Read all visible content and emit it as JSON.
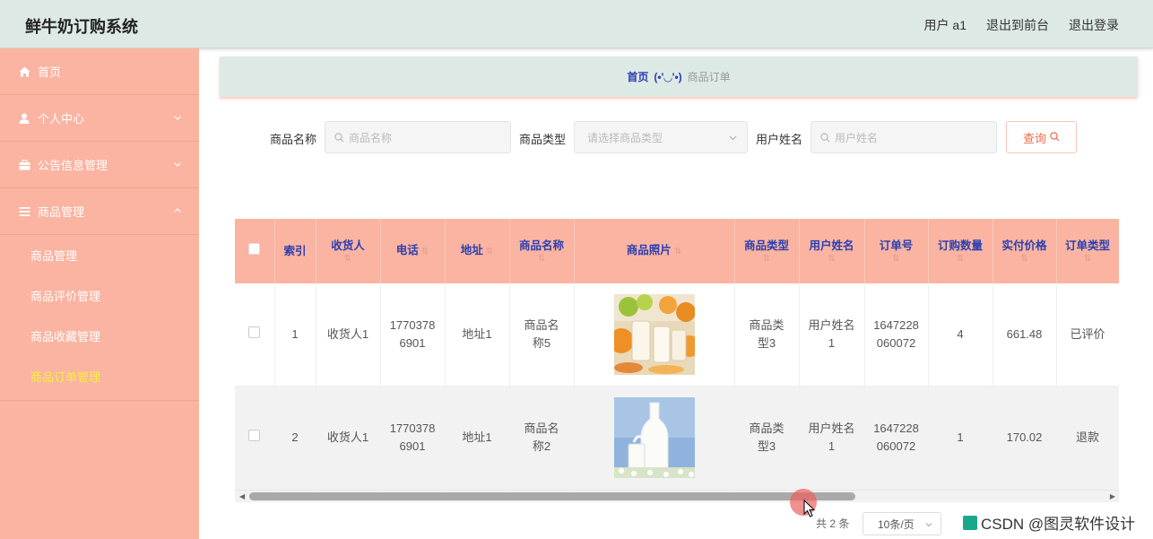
{
  "header": {
    "title": "鲜牛奶订购系统",
    "user": "用户 a1",
    "to_front": "退出到前台",
    "logout": "退出登录"
  },
  "sidebar": {
    "items": [
      {
        "label": "首页",
        "icon": "home-icon"
      },
      {
        "label": "个人中心",
        "icon": "user-icon"
      },
      {
        "label": "公告信息管理",
        "icon": "briefcase-icon"
      },
      {
        "label": "商品管理",
        "icon": "list-icon"
      }
    ],
    "subitems": [
      {
        "label": "商品管理"
      },
      {
        "label": "商品评价管理"
      },
      {
        "label": "商品收藏管理"
      },
      {
        "label": "商品订单管理",
        "active": true
      }
    ]
  },
  "breadcrumb": {
    "home": "首页",
    "separator": "(•'◡'•)",
    "current": "商品订单"
  },
  "search": {
    "name_label": "商品名称",
    "name_placeholder": "商品名称",
    "type_label": "商品类型",
    "type_placeholder": "请选择商品类型",
    "user_label": "用户姓名",
    "user_placeholder": "用户姓名",
    "query_button": "查询"
  },
  "table": {
    "columns": [
      "索引",
      "收货人",
      "电话",
      "地址",
      "商品名称",
      "商品照片",
      "商品类型",
      "用户姓名",
      "订单号",
      "订购数量",
      "实付价格",
      "订单类型"
    ],
    "rows": [
      {
        "index": "1",
        "receiver": "收货人1",
        "phone": "17703786901",
        "address": "地址1",
        "product": "商品名称5",
        "photo": "milk-glasses-with-fruit",
        "type": "商品类型3",
        "user": "用户姓名1",
        "order_no": "1647228060072",
        "qty": "4",
        "price": "661.48",
        "status": "已评价"
      },
      {
        "index": "2",
        "receiver": "收货人1",
        "phone": "17703786901",
        "address": "地址1",
        "product": "商品名称2",
        "photo": "milk-bottle-and-glass",
        "type": "商品类型3",
        "user": "用户姓名1",
        "order_no": "1647228060072",
        "qty": "1",
        "price": "170.02",
        "status": "退款"
      }
    ]
  },
  "pagination": {
    "total": "共 2 条",
    "page_size": "10条/页"
  },
  "watermark": "CSDN @图灵软件设计",
  "colors": {
    "sidebar_bg": "#fab4a1",
    "header_bg": "#dde9e4",
    "accent_text": "#2b3fb0",
    "active_menu": "#f8f03a"
  }
}
